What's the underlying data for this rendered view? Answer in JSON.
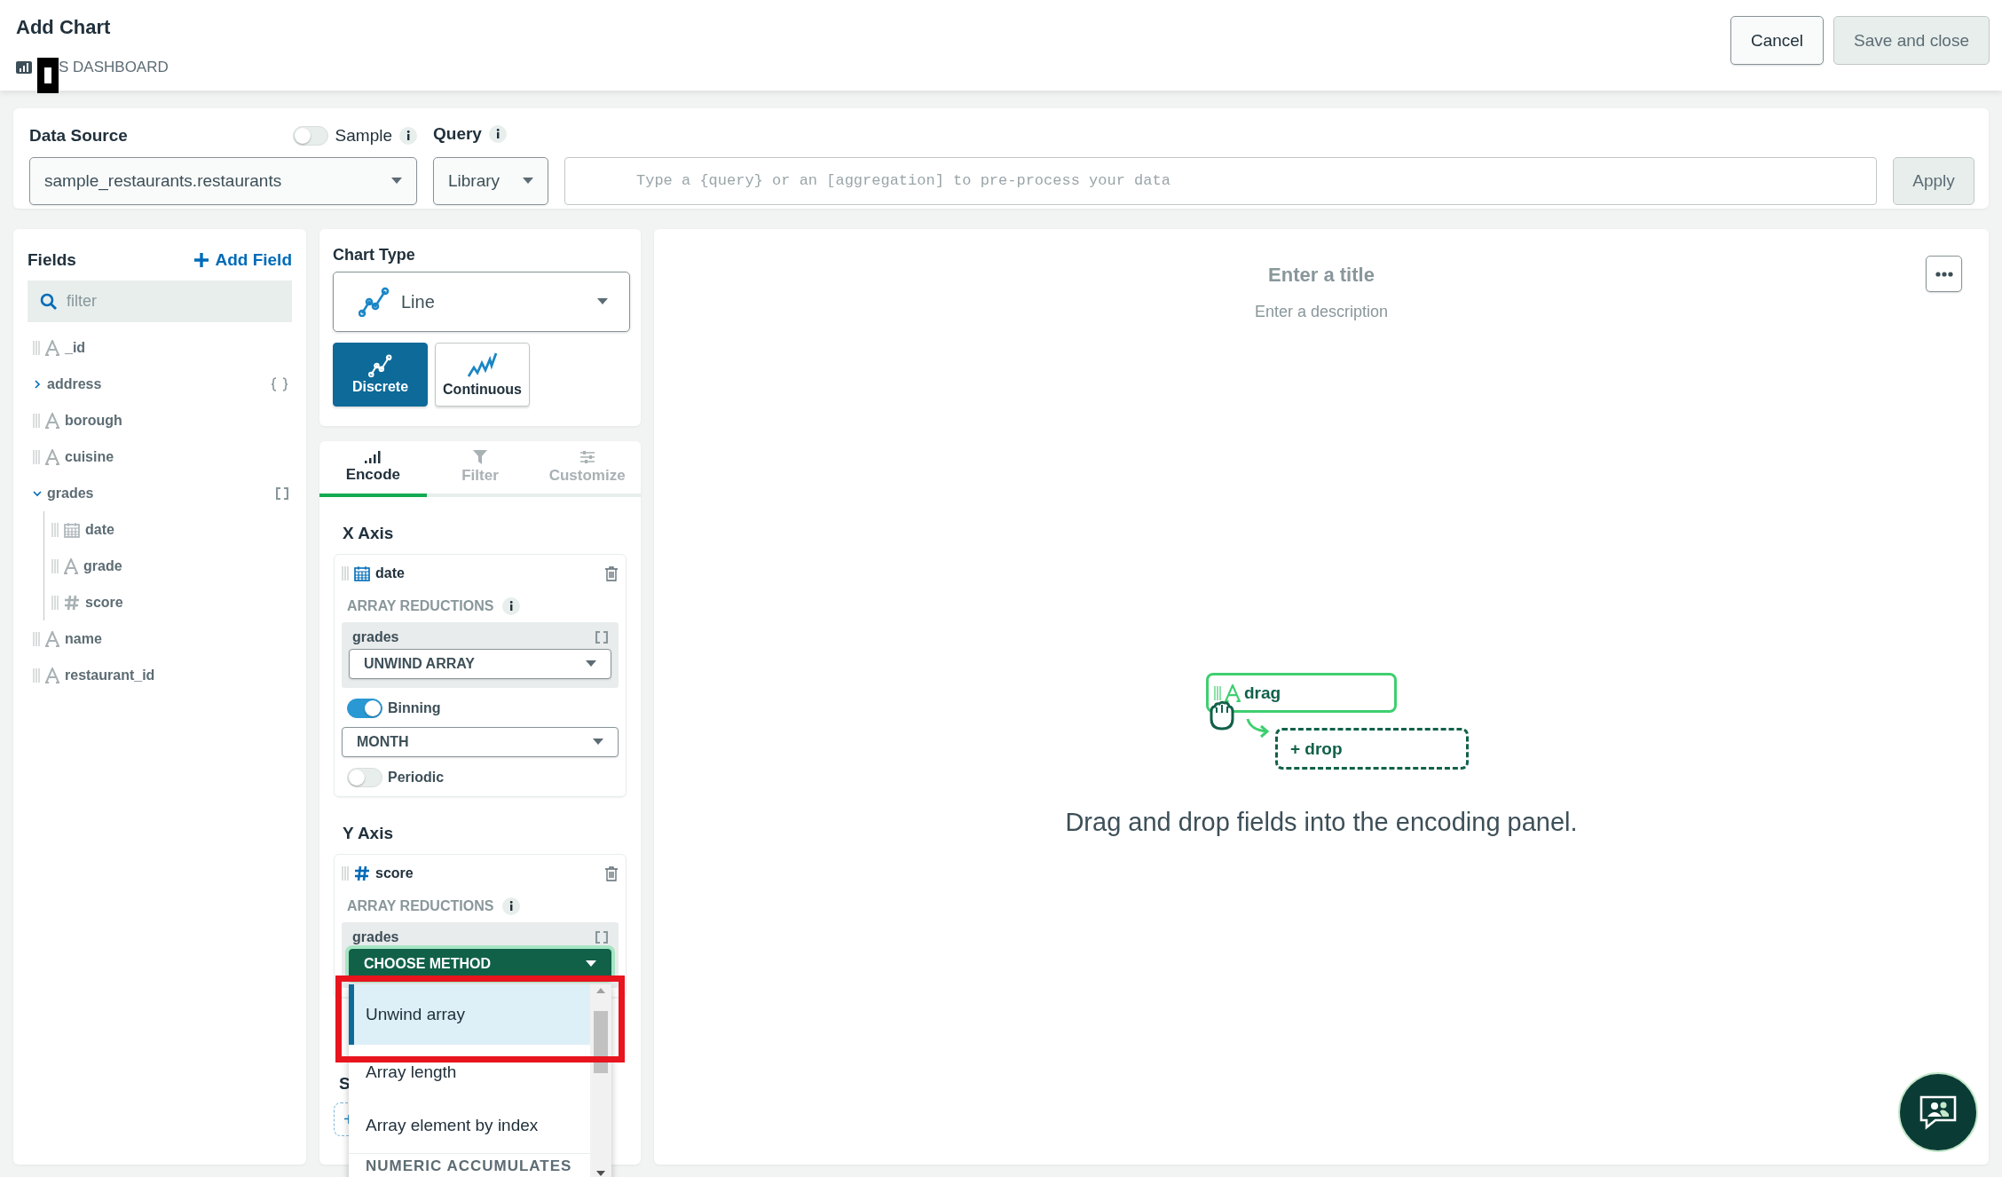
{
  "header": {
    "title": "Add Chart",
    "breadcrumb": "S DASHBOARD",
    "buttons": [
      {
        "label": "Cancel",
        "kind": "secondary"
      },
      {
        "label": "Save and close",
        "kind": "disabled"
      }
    ]
  },
  "data_source": {
    "label": "Data Source",
    "sample": {
      "label": "Sample",
      "on": false
    },
    "value": "sample_restaurants.restaurants",
    "query_label": "Query",
    "query_mode": "Library",
    "query": {
      "placeholder": "Type a {query} or an [aggregation] to pre-process your data"
    },
    "apply": "Apply"
  },
  "fields": {
    "title": "Fields",
    "add": "Add Field",
    "search": {
      "placeholder": "filter"
    },
    "items": [
      {
        "name": "_id",
        "kind": "string"
      },
      {
        "name": "address",
        "kind": "object",
        "expanded": false
      },
      {
        "name": "borough",
        "kind": "string"
      },
      {
        "name": "cuisine",
        "kind": "string"
      },
      {
        "name": "grades",
        "kind": "array",
        "expanded": true,
        "children": [
          {
            "name": "date",
            "kind": "date"
          },
          {
            "name": "grade",
            "kind": "string"
          },
          {
            "name": "score",
            "kind": "number"
          }
        ]
      },
      {
        "name": "name",
        "kind": "string"
      },
      {
        "name": "restaurant_id",
        "kind": "string"
      }
    ]
  },
  "chart_type": {
    "title": "Chart Type",
    "value": "Line",
    "variants": [
      {
        "label": "Discrete",
        "kind": "discrete",
        "selected": true
      },
      {
        "label": "Continuous",
        "kind": "continuous",
        "selected": false
      }
    ]
  },
  "encode": {
    "tabs": [
      {
        "label": "Encode",
        "kind": "encode",
        "selected": true
      },
      {
        "label": "Filter",
        "kind": "filter",
        "selected": false
      },
      {
        "label": "Customize",
        "kind": "customize",
        "selected": false
      }
    ],
    "channels": [
      {
        "title": "X Axis",
        "field": "date",
        "kind": "date",
        "reductions_label": "ARRAY REDUCTIONS",
        "array": "grades",
        "method": "UNWIND ARRAY",
        "method_chosen": true,
        "binning": {
          "label": "Binning",
          "on": true
        },
        "bin": "MONTH",
        "periodic": {
          "label": "Periodic",
          "on": false
        }
      },
      {
        "title": "Y Axis",
        "field": "score",
        "kind": "number",
        "reductions_label": "ARRAY REDUCTIONS",
        "array": "grades",
        "method": "CHOOSE METHOD",
        "method_chosen": false
      }
    ],
    "series_title": "S",
    "series_drop": "+"
  },
  "method_menu": {
    "items": [
      {
        "label": "Unwind array",
        "kind": "option",
        "selected": true
      },
      {
        "label": "Array length",
        "kind": "option",
        "selected": false
      },
      {
        "label": "Array element by index",
        "kind": "option",
        "selected": false
      },
      {
        "label": "NUMERIC ACCUMULATES",
        "kind": "group"
      }
    ]
  },
  "canvas": {
    "title": {
      "placeholder": "Enter a title"
    },
    "description": {
      "placeholder": "Enter a description"
    },
    "drag_label": "drag",
    "drop_label": "+ drop",
    "hint": "Drag and drop fields into the encoding panel."
  }
}
